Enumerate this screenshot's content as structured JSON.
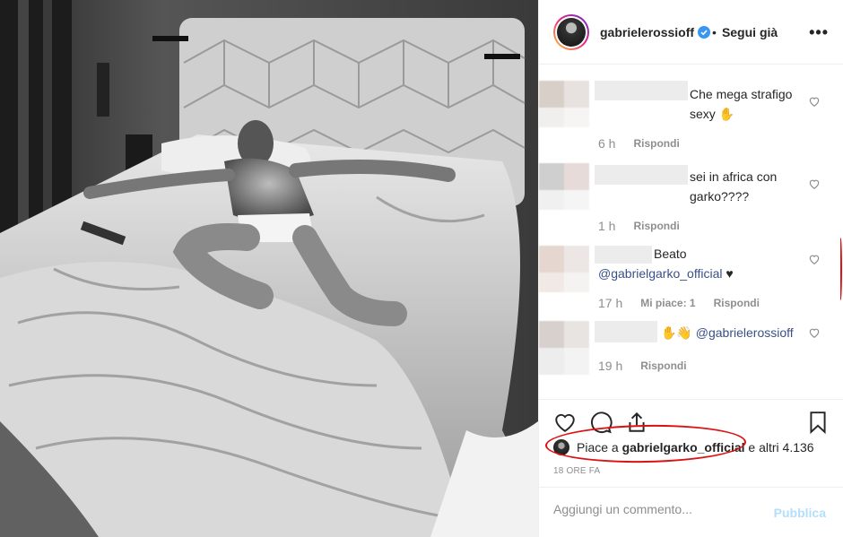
{
  "post": {
    "username": "gabrielerossioff",
    "follow_label": "Segui già",
    "dot": "•",
    "more": "•••"
  },
  "comments": [
    {
      "text": "Che mega strafigo sexy ✋",
      "time": "6 h",
      "reply": "Rispondi",
      "likes": ""
    },
    {
      "text": "sei in africa con garko????",
      "time": "1 h",
      "reply": "Rispondi",
      "likes": ""
    },
    {
      "text_prefix": "Beato",
      "mention": "@gabrielgarko_official",
      "text_suffix": "♥",
      "time": "17 h",
      "likes": "Mi piace: 1",
      "reply": "Rispondi"
    },
    {
      "text_prefix": "✋👋",
      "mention": "@gabrielerossioff",
      "time": "19 h",
      "reply": "Rispondi"
    }
  ],
  "likes": {
    "prefix": "Piace a",
    "user": "gabrielgarko_official",
    "suffix": "e altri 4.136"
  },
  "time_ago": "18 ORE FA",
  "add_comment": {
    "placeholder": "Aggiungi un commento...",
    "publish": "Pubblica"
  },
  "colors": {
    "accent": "#3897f0",
    "annotation": "#dd1111"
  }
}
